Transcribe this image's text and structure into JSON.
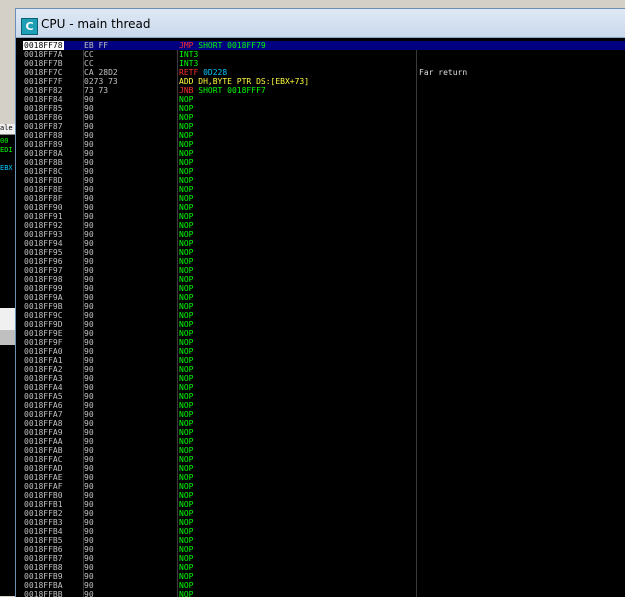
{
  "colors": {
    "window_bg": "#000000",
    "title_bar": "#c9d9ec",
    "selection_bg": "#000080",
    "address": "#c0c0c0",
    "hex": "#c0c0c0",
    "jump_mnemonic": "#ff3030",
    "jump_operand": "#00ff00",
    "int3": "#00ff00",
    "nop": "#00ff00",
    "retf_mnemonic": "#ff3030",
    "retf_operand": "#00c8ff",
    "add": "#ffff40",
    "comment": "#e0e0e0"
  },
  "window": {
    "title": "CPU - main thread",
    "icon_letter": "C",
    "icon": "cpu-window-icon"
  },
  "background_window": {
    "lines": [
      "ale",
      "00",
      "EDI",
      "",
      "EBX"
    ]
  },
  "disasm": {
    "rows": [
      {
        "addr": "0018FF78",
        "hex": "EB FF",
        "mn": "JMP",
        "op": " SHORT 0018FF79",
        "kind": "jmp",
        "comment": "",
        "selected": true
      },
      {
        "addr": "0018FF7A",
        "hex": "CC",
        "mn": "INT3",
        "op": "",
        "kind": "int3",
        "comment": ""
      },
      {
        "addr": "0018FF7B",
        "hex": "CC",
        "mn": "INT3",
        "op": "",
        "kind": "int3",
        "comment": ""
      },
      {
        "addr": "0018FF7C",
        "hex": "CA 28D2",
        "mn": "RETF",
        "op": " 0D228",
        "kind": "retf",
        "comment": "Far return"
      },
      {
        "addr": "0018FF7F",
        "hex": "0273 73",
        "mn": "ADD DH,BYTE PTR DS:[EBX+73]",
        "op": "",
        "kind": "add",
        "comment": ""
      },
      {
        "addr": "0018FF82",
        "hex": "73 73",
        "mn": "JNB",
        "op": " SHORT 0018FFF7",
        "kind": "jmp",
        "comment": ""
      },
      {
        "addr": "0018FF84",
        "hex": "90",
        "mn": "NOP",
        "op": "",
        "kind": "nop",
        "comment": ""
      },
      {
        "addr": "0018FF85",
        "hex": "90",
        "mn": "NOP",
        "op": "",
        "kind": "nop",
        "comment": ""
      },
      {
        "addr": "0018FF86",
        "hex": "90",
        "mn": "NOP",
        "op": "",
        "kind": "nop",
        "comment": ""
      },
      {
        "addr": "0018FF87",
        "hex": "90",
        "mn": "NOP",
        "op": "",
        "kind": "nop",
        "comment": ""
      },
      {
        "addr": "0018FF88",
        "hex": "90",
        "mn": "NOP",
        "op": "",
        "kind": "nop",
        "comment": ""
      },
      {
        "addr": "0018FF89",
        "hex": "90",
        "mn": "NOP",
        "op": "",
        "kind": "nop",
        "comment": ""
      },
      {
        "addr": "0018FF8A",
        "hex": "90",
        "mn": "NOP",
        "op": "",
        "kind": "nop",
        "comment": ""
      },
      {
        "addr": "0018FF8B",
        "hex": "90",
        "mn": "NOP",
        "op": "",
        "kind": "nop",
        "comment": ""
      },
      {
        "addr": "0018FF8C",
        "hex": "90",
        "mn": "NOP",
        "op": "",
        "kind": "nop",
        "comment": ""
      },
      {
        "addr": "0018FF8D",
        "hex": "90",
        "mn": "NOP",
        "op": "",
        "kind": "nop",
        "comment": ""
      },
      {
        "addr": "0018FF8E",
        "hex": "90",
        "mn": "NOP",
        "op": "",
        "kind": "nop",
        "comment": ""
      },
      {
        "addr": "0018FF8F",
        "hex": "90",
        "mn": "NOP",
        "op": "",
        "kind": "nop",
        "comment": ""
      },
      {
        "addr": "0018FF90",
        "hex": "90",
        "mn": "NOP",
        "op": "",
        "kind": "nop",
        "comment": ""
      },
      {
        "addr": "0018FF91",
        "hex": "90",
        "mn": "NOP",
        "op": "",
        "kind": "nop",
        "comment": ""
      },
      {
        "addr": "0018FF92",
        "hex": "90",
        "mn": "NOP",
        "op": "",
        "kind": "nop",
        "comment": ""
      },
      {
        "addr": "0018FF93",
        "hex": "90",
        "mn": "NOP",
        "op": "",
        "kind": "nop",
        "comment": ""
      },
      {
        "addr": "0018FF94",
        "hex": "90",
        "mn": "NOP",
        "op": "",
        "kind": "nop",
        "comment": ""
      },
      {
        "addr": "0018FF95",
        "hex": "90",
        "mn": "NOP",
        "op": "",
        "kind": "nop",
        "comment": ""
      },
      {
        "addr": "0018FF96",
        "hex": "90",
        "mn": "NOP",
        "op": "",
        "kind": "nop",
        "comment": ""
      },
      {
        "addr": "0018FF97",
        "hex": "90",
        "mn": "NOP",
        "op": "",
        "kind": "nop",
        "comment": ""
      },
      {
        "addr": "0018FF98",
        "hex": "90",
        "mn": "NOP",
        "op": "",
        "kind": "nop",
        "comment": ""
      },
      {
        "addr": "0018FF99",
        "hex": "90",
        "mn": "NOP",
        "op": "",
        "kind": "nop",
        "comment": ""
      },
      {
        "addr": "0018FF9A",
        "hex": "90",
        "mn": "NOP",
        "op": "",
        "kind": "nop",
        "comment": ""
      },
      {
        "addr": "0018FF9B",
        "hex": "90",
        "mn": "NOP",
        "op": "",
        "kind": "nop",
        "comment": ""
      },
      {
        "addr": "0018FF9C",
        "hex": "90",
        "mn": "NOP",
        "op": "",
        "kind": "nop",
        "comment": ""
      },
      {
        "addr": "0018FF9D",
        "hex": "90",
        "mn": "NOP",
        "op": "",
        "kind": "nop",
        "comment": ""
      },
      {
        "addr": "0018FF9E",
        "hex": "90",
        "mn": "NOP",
        "op": "",
        "kind": "nop",
        "comment": ""
      },
      {
        "addr": "0018FF9F",
        "hex": "90",
        "mn": "NOP",
        "op": "",
        "kind": "nop",
        "comment": ""
      },
      {
        "addr": "0018FFA0",
        "hex": "90",
        "mn": "NOP",
        "op": "",
        "kind": "nop",
        "comment": ""
      },
      {
        "addr": "0018FFA1",
        "hex": "90",
        "mn": "NOP",
        "op": "",
        "kind": "nop",
        "comment": ""
      },
      {
        "addr": "0018FFA2",
        "hex": "90",
        "mn": "NOP",
        "op": "",
        "kind": "nop",
        "comment": ""
      },
      {
        "addr": "0018FFA3",
        "hex": "90",
        "mn": "NOP",
        "op": "",
        "kind": "nop",
        "comment": ""
      },
      {
        "addr": "0018FFA4",
        "hex": "90",
        "mn": "NOP",
        "op": "",
        "kind": "nop",
        "comment": ""
      },
      {
        "addr": "0018FFA5",
        "hex": "90",
        "mn": "NOP",
        "op": "",
        "kind": "nop",
        "comment": ""
      },
      {
        "addr": "0018FFA6",
        "hex": "90",
        "mn": "NOP",
        "op": "",
        "kind": "nop",
        "comment": ""
      },
      {
        "addr": "0018FFA7",
        "hex": "90",
        "mn": "NOP",
        "op": "",
        "kind": "nop",
        "comment": ""
      },
      {
        "addr": "0018FFA8",
        "hex": "90",
        "mn": "NOP",
        "op": "",
        "kind": "nop",
        "comment": ""
      },
      {
        "addr": "0018FFA9",
        "hex": "90",
        "mn": "NOP",
        "op": "",
        "kind": "nop",
        "comment": ""
      },
      {
        "addr": "0018FFAA",
        "hex": "90",
        "mn": "NOP",
        "op": "",
        "kind": "nop",
        "comment": ""
      },
      {
        "addr": "0018FFAB",
        "hex": "90",
        "mn": "NOP",
        "op": "",
        "kind": "nop",
        "comment": ""
      },
      {
        "addr": "0018FFAC",
        "hex": "90",
        "mn": "NOP",
        "op": "",
        "kind": "nop",
        "comment": ""
      },
      {
        "addr": "0018FFAD",
        "hex": "90",
        "mn": "NOP",
        "op": "",
        "kind": "nop",
        "comment": ""
      },
      {
        "addr": "0018FFAE",
        "hex": "90",
        "mn": "NOP",
        "op": "",
        "kind": "nop",
        "comment": ""
      },
      {
        "addr": "0018FFAF",
        "hex": "90",
        "mn": "NOP",
        "op": "",
        "kind": "nop",
        "comment": ""
      },
      {
        "addr": "0018FFB0",
        "hex": "90",
        "mn": "NOP",
        "op": "",
        "kind": "nop",
        "comment": ""
      },
      {
        "addr": "0018FFB1",
        "hex": "90",
        "mn": "NOP",
        "op": "",
        "kind": "nop",
        "comment": ""
      },
      {
        "addr": "0018FFB2",
        "hex": "90",
        "mn": "NOP",
        "op": "",
        "kind": "nop",
        "comment": ""
      },
      {
        "addr": "0018FFB3",
        "hex": "90",
        "mn": "NOP",
        "op": "",
        "kind": "nop",
        "comment": ""
      },
      {
        "addr": "0018FFB4",
        "hex": "90",
        "mn": "NOP",
        "op": "",
        "kind": "nop",
        "comment": ""
      },
      {
        "addr": "0018FFB5",
        "hex": "90",
        "mn": "NOP",
        "op": "",
        "kind": "nop",
        "comment": ""
      },
      {
        "addr": "0018FFB6",
        "hex": "90",
        "mn": "NOP",
        "op": "",
        "kind": "nop",
        "comment": ""
      },
      {
        "addr": "0018FFB7",
        "hex": "90",
        "mn": "NOP",
        "op": "",
        "kind": "nop",
        "comment": ""
      },
      {
        "addr": "0018FFB8",
        "hex": "90",
        "mn": "NOP",
        "op": "",
        "kind": "nop",
        "comment": ""
      },
      {
        "addr": "0018FFB9",
        "hex": "90",
        "mn": "NOP",
        "op": "",
        "kind": "nop",
        "comment": ""
      },
      {
        "addr": "0018FFBA",
        "hex": "90",
        "mn": "NOP",
        "op": "",
        "kind": "nop",
        "comment": ""
      },
      {
        "addr": "0018FFBB",
        "hex": "90",
        "mn": "NOP",
        "op": "",
        "kind": "nop",
        "comment": ""
      }
    ]
  }
}
